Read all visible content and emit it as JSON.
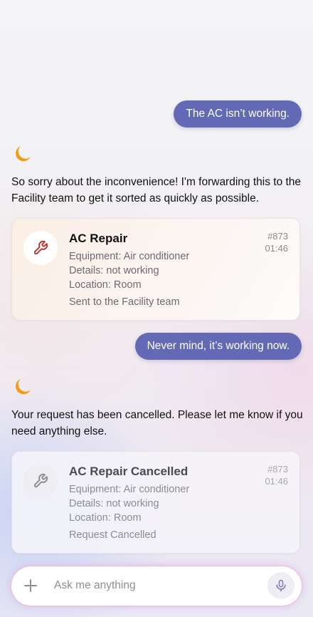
{
  "messages": {
    "user1": "The AC isn’t working.",
    "bot1": "So sorry about the inconvenience! I'm forwarding this to the Facility team to get it sorted as quickly as possible.",
    "user2": "Never mind, it’s working now.",
    "bot2": "Your request has been cancelled. Please let me know if you need anything else."
  },
  "card1": {
    "title": "AC Repair",
    "number": "#873",
    "time": "01:46",
    "equipment": "Equipment: Air conditioner",
    "details": "Details: not working",
    "location": "Location: Room",
    "status": "Sent to the Facility team",
    "icon": "wrench-icon",
    "icon_color": "#b4302a"
  },
  "card2": {
    "title": "AC Repair Cancelled",
    "number": "#873",
    "time": "01:46",
    "equipment": "Equipment: Air conditioner",
    "details": "Details: not working",
    "location": "Location: Room",
    "status": "Request Cancelled",
    "icon": "wrench-icon",
    "icon_color": "#8a8a92"
  },
  "input": {
    "placeholder": "Ask me anything"
  },
  "colors": {
    "user_bubble": "#6369b4",
    "assistant_moon": "#f59a10"
  }
}
